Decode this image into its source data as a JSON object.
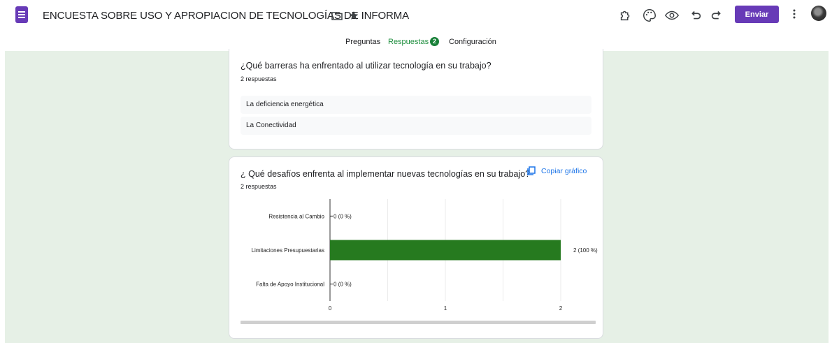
{
  "header": {
    "title": "ENCUESTA SOBRE USO Y APROPIACION DE TECNOLOGÍAS DE INFORMA",
    "send_label": "Enviar",
    "icons": [
      "forms-logo-icon",
      "folder-icon",
      "star-icon",
      "addon-puzzle-icon",
      "palette-icon",
      "preview-eye-icon",
      "undo-icon",
      "redo-icon",
      "more-vert-icon",
      "avatar"
    ]
  },
  "tabs": {
    "questions": "Preguntas",
    "responses": "Respuestas",
    "responses_count": "2",
    "settings": "Configuración"
  },
  "cards": [
    {
      "title": "¿Qué barreras ha enfrentado al utilizar tecnología en su trabajo?",
      "count": "2 respuestas",
      "answers": [
        "La deficiencia energética",
        "La Conectividad"
      ]
    },
    {
      "title": "¿  Qué desafíos enfrenta al implementar nuevas tecnologías en su trabajo?",
      "count": "2 respuestas",
      "copy_label": "Copiar gráfico"
    }
  ],
  "colors": {
    "accent_purple": "#673ab7",
    "accent_green": "#188038",
    "bar_green": "#267a1f",
    "background": "#e6f0e6"
  },
  "chart_data": {
    "type": "bar",
    "orientation": "horizontal",
    "categories": [
      "Resistencia al Cambio",
      "Limitaciones Presupuestarias",
      "Falta de Apoyo Institucional"
    ],
    "values": [
      0,
      2,
      0
    ],
    "data_labels": [
      "0 (0 %)",
      "2 (100 %)",
      "0 (0 %)"
    ],
    "xticks": [
      "0",
      "1",
      "2"
    ],
    "xlim": [
      0,
      2
    ],
    "grid": true
  }
}
